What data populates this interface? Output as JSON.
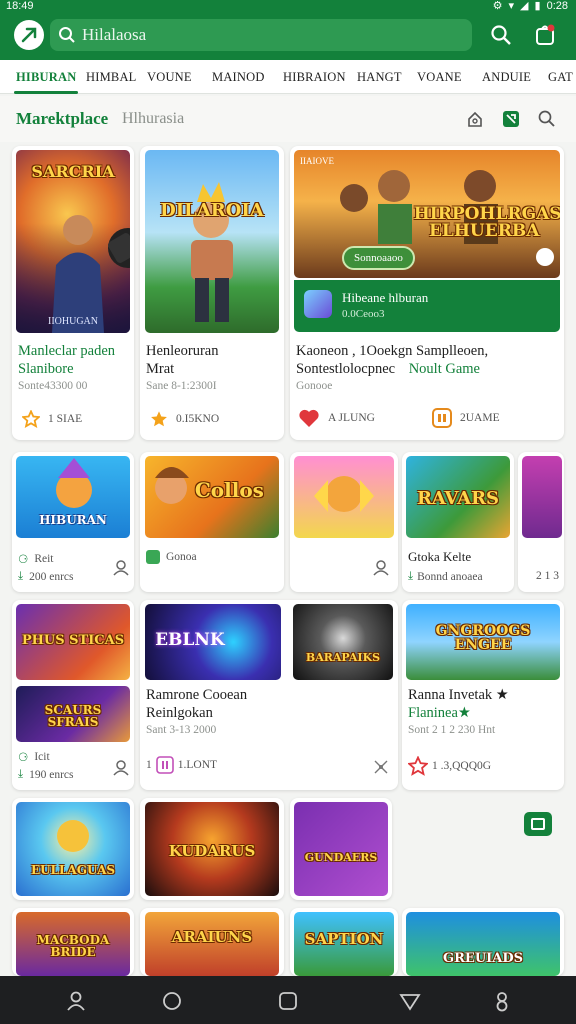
{
  "status_bar": {
    "time": "18:49",
    "right_time": "0:28"
  },
  "app_bar": {
    "logo_icon": "leaf-logo-icon",
    "search_text": "Hilalaosa",
    "search_icon": "search-icon",
    "cart_icon": "cart-icon"
  },
  "tabs": [
    "HIBURAN",
    "HIMBAL",
    "VOUNE",
    "MAINOD",
    "HIBRAION",
    "HANGT",
    "VOANE",
    "ANDUIE",
    "GAT"
  ],
  "section": {
    "title": "Marektplace",
    "subtitle": "Hlhurasia"
  },
  "featured": [
    {
      "logo": "SARCRIA",
      "bottom_label": "IIOHUGAN",
      "title_line1": "Manleclar paden",
      "title_line2": "Slanibore",
      "meta": "Sonte43300 00",
      "rating": "1 SIAE"
    },
    {
      "logo": "DILAROIA",
      "title_line1": "Henleoruran",
      "title_line2": "Mrat",
      "meta": "Sane 8-1:2300I",
      "rating": "0.I5KNO"
    },
    {
      "logo": "HIRPOHLRGAS ELHUERBA",
      "overlay_tag": "IIAIOVE",
      "pill_label": "Sonnoaaoo",
      "strip_title": "Hibeane hlburan",
      "strip_meta": "0.0Ceoo3",
      "title_line1": "Kaoneon , 1Ooekgn Samplleoen,",
      "title_line2": "Sontestlolocpnec",
      "title_tail": "Noult Game",
      "meta": "Gonooe",
      "rating_left": "A JLUNG",
      "rating_right": "2UAME"
    }
  ],
  "row2": [
    {
      "logo": "HIBURAN"
    },
    {
      "logo": "Collos"
    },
    {
      "logo": ""
    },
    {
      "logo": "RAVARS"
    },
    {
      "logo": ""
    }
  ],
  "row2_info": {
    "c1_line1": "Reit",
    "c1_line2": "200 enrcs",
    "c2_label": "Gonoa",
    "c4_title": "Gtoka Kelte",
    "c4_meta": "Bonnd anoaea",
    "c5_meta": "2 1 3"
  },
  "row3": [
    {
      "logo": "PHUS STICAS"
    },
    {
      "logo": "EBLNK"
    },
    {
      "logo": "BARAPAIKS"
    },
    {
      "logo": "GNGROOGS ENGEE"
    },
    {
      "logo": "SCAURS SFRAIS"
    }
  ],
  "row3_info": {
    "c1_line1": "Icit",
    "c1_line2": "190 enrcs",
    "mid_title1": "Ramrone Cooean",
    "mid_title2": "Reinlgokan",
    "mid_meta": "Sant 3-13 2000",
    "mid_rating": "1.LONT",
    "right_title1": "Ranna Invetak ★",
    "right_title2": "Flaninea★",
    "right_meta": "Sont 2 1 2 230 Hnt",
    "right_rating": "1 .3,QQQ0G"
  },
  "row4": [
    {
      "logo": "EULLAGUAS"
    },
    {
      "logo": "KUDARUS"
    },
    {
      "logo": "GUNDAERS"
    }
  ],
  "row5": [
    {
      "logo": "MACBODA BRIDE"
    },
    {
      "logo": "ARAIUNS"
    },
    {
      "logo": "SAPTION"
    },
    {
      "logo": "GREUIADS"
    }
  ],
  "nav": [
    "person-icon",
    "home-circle-icon",
    "square-icon",
    "triangle-icon",
    "profile-icon"
  ],
  "colors": {
    "brand": "#13813b",
    "star": "#f4a21a",
    "heart": "#e0373c"
  }
}
